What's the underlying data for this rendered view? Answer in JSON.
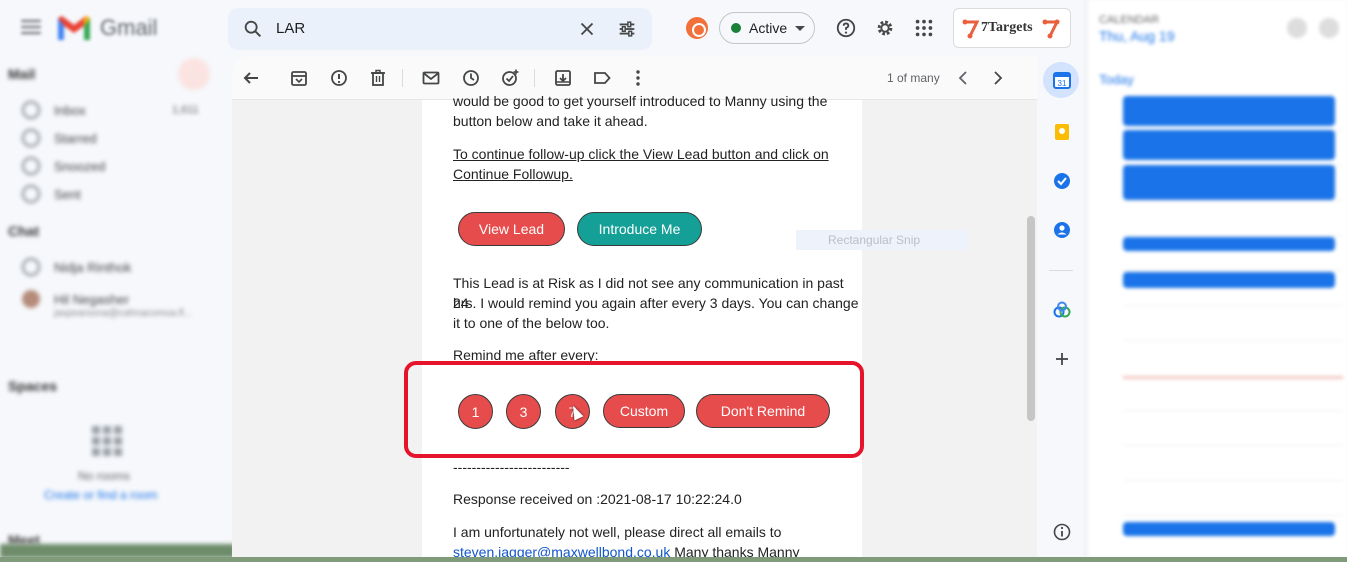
{
  "header": {
    "app_name": "Gmail",
    "search_query": "LAR",
    "status": "Active",
    "brand": "7Targets"
  },
  "toolbar": {
    "pager": "1 of many"
  },
  "leftnav": {
    "items": [
      {
        "label": "Inbox",
        "count": "1,611"
      },
      {
        "label": "Starred",
        "count": ""
      },
      {
        "label": "Snoozed",
        "count": ""
      },
      {
        "label": "Sent",
        "count": ""
      }
    ],
    "sections": [
      "Mail",
      "Chat",
      "Spaces",
      "Meet"
    ],
    "chat_items": [
      "Nidja Rinthok",
      "Hil Negasher"
    ],
    "chat_sub": "jaspearsona@cahnacomoa.fl...",
    "rooms_text": "No rooms",
    "rooms_link": "Create or find a room"
  },
  "email": {
    "line1": "would be good to get yourself introduced to Manny using the",
    "line2": "button below and take it ahead.",
    "followup_line1": "To continue follow-up click the View Lead button and click on",
    "followup_line2": "Continue Followup.",
    "snip_overlay": "Rectangular Snip",
    "view_lead": "View Lead",
    "introduce_me": "Introduce Me",
    "risk_line1": "This Lead is at Risk as I did not see any communication in past 24",
    "risk_line2": "hrs. I would remind you again after every 3 days. You can change",
    "risk_line3": "it to one of the below too.",
    "remind_label": "Remind me after every:",
    "remind_options": [
      "1",
      "3",
      "7"
    ],
    "custom": "Custom",
    "dont_remind": "Don't Remind",
    "separator": "-------------------------",
    "response": "Response received on :2021-08-17 10:22:24.0",
    "reply_line": "I am unfortunately not well, please direct all emails to",
    "reply_email": "steven.jagger@maxwellbond.co.uk",
    "reply_tail": " Many thanks Manny"
  },
  "calendar": {
    "header": "CALENDAR",
    "date": "Thu, Aug 19",
    "today": "Today"
  },
  "colors": {
    "action_red": "#e74c4c",
    "action_teal": "#14a096",
    "highlight_red": "#e5142b",
    "status_green": "#188038"
  },
  "icons": [
    "menu-icon",
    "search-icon",
    "close-icon",
    "filter-icon",
    "help-icon",
    "gear-icon",
    "apps-icon",
    "back-icon",
    "archive-icon",
    "report-icon",
    "delete-icon",
    "mail-icon",
    "clock-icon",
    "task-icon",
    "move-icon",
    "label-icon",
    "more-icon",
    "calendar-icon",
    "keep-icon",
    "tasks-icon",
    "contacts-icon",
    "addon-icon",
    "add-icon",
    "info-icon"
  ]
}
